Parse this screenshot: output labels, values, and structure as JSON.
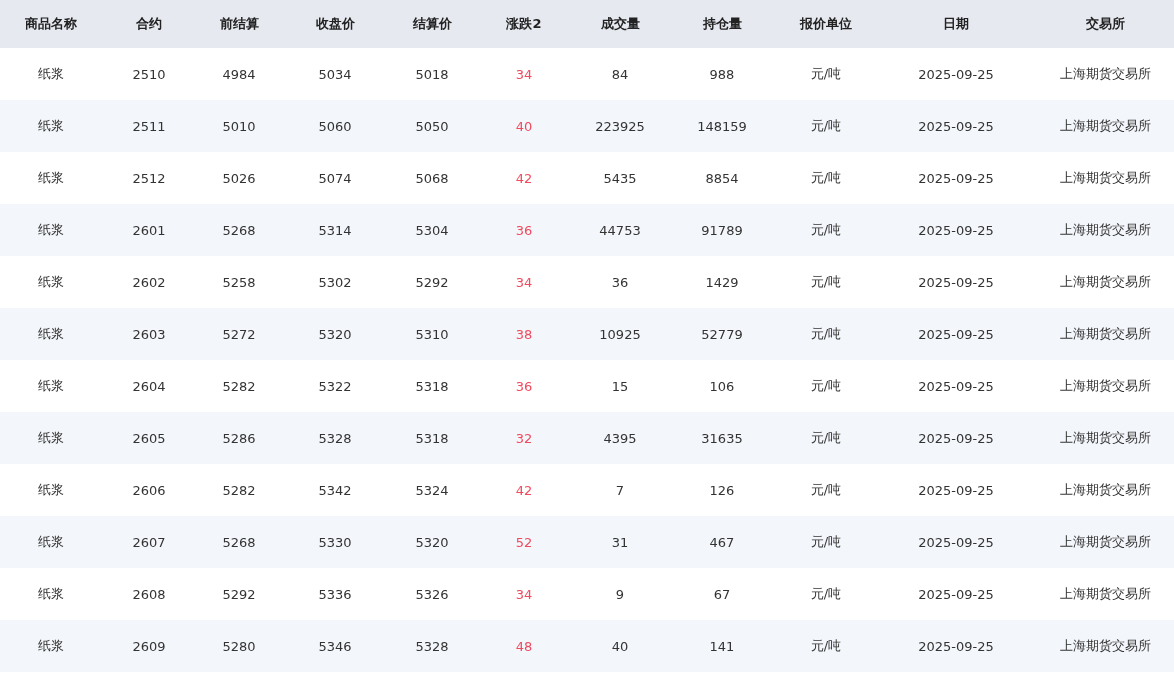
{
  "table": {
    "columns": [
      {
        "label": "商品名称",
        "kind": "text"
      },
      {
        "label": "合约",
        "kind": "text"
      },
      {
        "label": "前结算",
        "kind": "text"
      },
      {
        "label": "收盘价",
        "kind": "text"
      },
      {
        "label": "结算价",
        "kind": "text"
      },
      {
        "label": "涨跌2",
        "kind": "change"
      },
      {
        "label": "成交量",
        "kind": "text"
      },
      {
        "label": "持仓量",
        "kind": "text"
      },
      {
        "label": "报价单位",
        "kind": "text"
      },
      {
        "label": "日期",
        "kind": "text"
      },
      {
        "label": "交易所",
        "kind": "text"
      }
    ],
    "rows": [
      [
        "纸浆",
        "2510",
        "4984",
        "5034",
        "5018",
        "34",
        "84",
        "988",
        "元/吨",
        "2025-09-25",
        "上海期货交易所"
      ],
      [
        "纸浆",
        "2511",
        "5010",
        "5060",
        "5050",
        "40",
        "223925",
        "148159",
        "元/吨",
        "2025-09-25",
        "上海期货交易所"
      ],
      [
        "纸浆",
        "2512",
        "5026",
        "5074",
        "5068",
        "42",
        "5435",
        "8854",
        "元/吨",
        "2025-09-25",
        "上海期货交易所"
      ],
      [
        "纸浆",
        "2601",
        "5268",
        "5314",
        "5304",
        "36",
        "44753",
        "91789",
        "元/吨",
        "2025-09-25",
        "上海期货交易所"
      ],
      [
        "纸浆",
        "2602",
        "5258",
        "5302",
        "5292",
        "34",
        "36",
        "1429",
        "元/吨",
        "2025-09-25",
        "上海期货交易所"
      ],
      [
        "纸浆",
        "2603",
        "5272",
        "5320",
        "5310",
        "38",
        "10925",
        "52779",
        "元/吨",
        "2025-09-25",
        "上海期货交易所"
      ],
      [
        "纸浆",
        "2604",
        "5282",
        "5322",
        "5318",
        "36",
        "15",
        "106",
        "元/吨",
        "2025-09-25",
        "上海期货交易所"
      ],
      [
        "纸浆",
        "2605",
        "5286",
        "5328",
        "5318",
        "32",
        "4395",
        "31635",
        "元/吨",
        "2025-09-25",
        "上海期货交易所"
      ],
      [
        "纸浆",
        "2606",
        "5282",
        "5342",
        "5324",
        "42",
        "7",
        "126",
        "元/吨",
        "2025-09-25",
        "上海期货交易所"
      ],
      [
        "纸浆",
        "2607",
        "5268",
        "5330",
        "5320",
        "52",
        "31",
        "467",
        "元/吨",
        "2025-09-25",
        "上海期货交易所"
      ],
      [
        "纸浆",
        "2608",
        "5292",
        "5336",
        "5326",
        "34",
        "9",
        "67",
        "元/吨",
        "2025-09-25",
        "上海期货交易所"
      ],
      [
        "纸浆",
        "2609",
        "5280",
        "5346",
        "5328",
        "48",
        "40",
        "141",
        "元/吨",
        "2025-09-25",
        "上海期货交易所"
      ]
    ]
  }
}
